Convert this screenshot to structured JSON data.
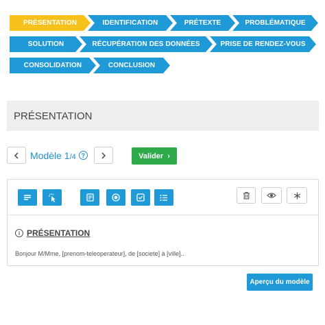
{
  "steps": {
    "row1": [
      "PRÉSENTATION",
      "IDENTIFICATION",
      "PRÉTEXTE",
      "PROBLÉMATIQUE"
    ],
    "row2": [
      "SOLUTION",
      "RÉCUPÉRATION DES DONNÉES",
      "PRISE DE RENDEZ-VOUS"
    ],
    "row3": [
      "CONSOLIDATION",
      "CONCLUSION"
    ],
    "active": "PRÉSENTATION"
  },
  "section": {
    "title": "PRÉSENTATION"
  },
  "model": {
    "label": "Modèle 1",
    "total": "/4",
    "help": "?"
  },
  "valider": {
    "label": "Valider",
    "arrow": "›"
  },
  "editor": {
    "content_title": "PRÉSENTATION",
    "content_text": "Bonjour M/Mme, [prenom-teleoperateur], de [societe] à [ville].."
  },
  "apercu": {
    "label": "Aperçu du modèle"
  },
  "icons": {
    "prev": "chevron-left-icon",
    "next": "chevron-right-icon",
    "toolbar": [
      "text-lines-icon",
      "click-pointer-icon",
      "document-icon",
      "radio-icon",
      "checkbox-icon",
      "list-icon"
    ],
    "actions": [
      "trash-icon",
      "eye-icon",
      "asterisk-icon"
    ]
  },
  "colors": {
    "accent": "#1f9ad6",
    "active_step": "#f5c11a",
    "success": "#2eaa4a"
  }
}
